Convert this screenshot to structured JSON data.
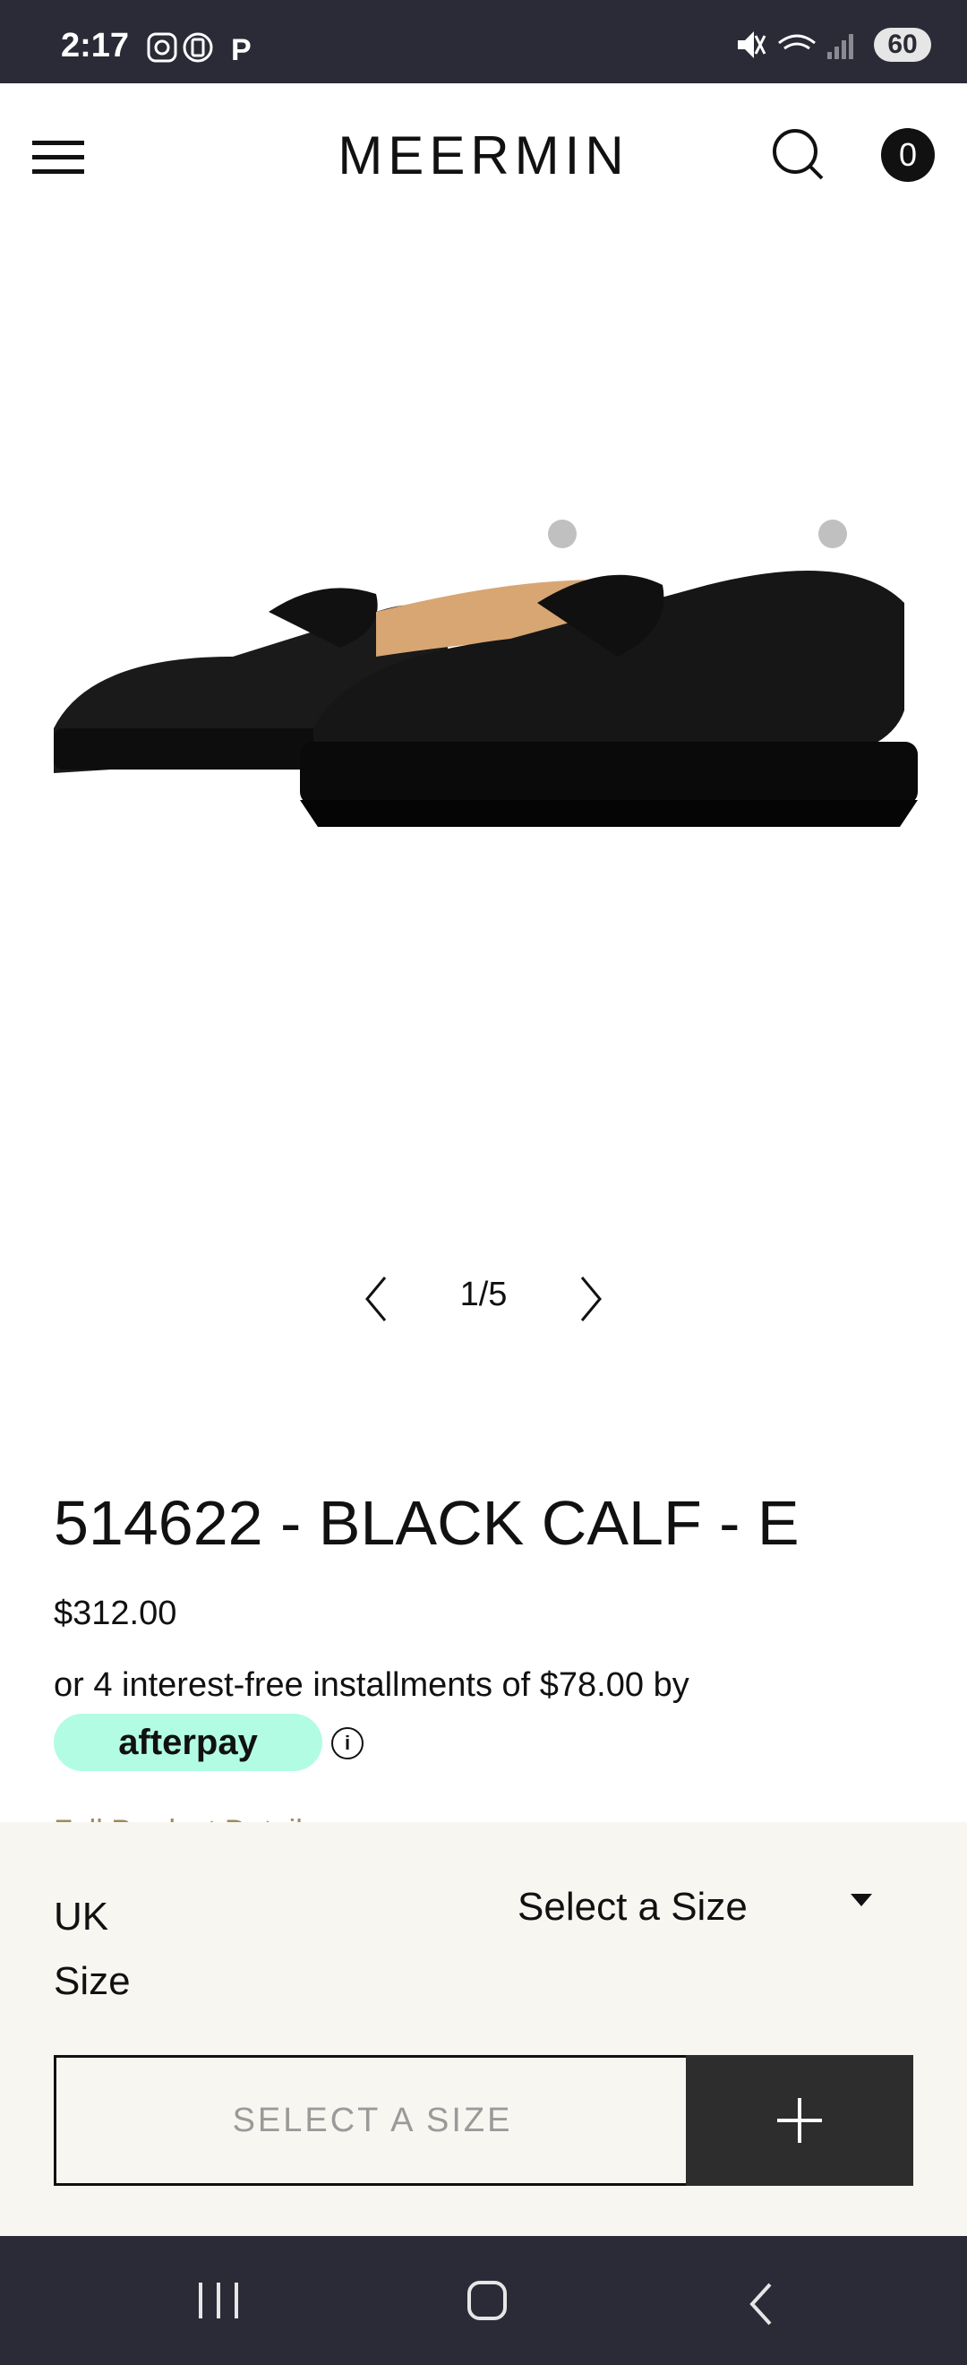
{
  "status_bar": {
    "time": "2:17",
    "left_icons": [
      "instagram-icon",
      "message-icon",
      "p-icon"
    ],
    "right_icons": [
      "mute-icon",
      "wifi-icon",
      "signal-icon"
    ],
    "battery": "60"
  },
  "header": {
    "brand": "MEERMIN",
    "cart_count": "0"
  },
  "gallery": {
    "counter": "1/5"
  },
  "product": {
    "title": "514622 - BLACK CALF - E",
    "price": "$312.00",
    "afterpay_text": "or 4 interest-free installments of $78.00 by",
    "afterpay_brand": "afterpay",
    "details_link": "Full Product Details"
  },
  "purchase": {
    "size_label": "UK Size",
    "size_select": "Select a Size",
    "cta_label": "SELECT A SIZE"
  },
  "colors": {
    "status_bar_bg": "#2a2b36",
    "afterpay_mint": "#b2fce4",
    "drawer_bg": "#f7f6f1",
    "plus_button_bg": "#2d2d2d"
  }
}
